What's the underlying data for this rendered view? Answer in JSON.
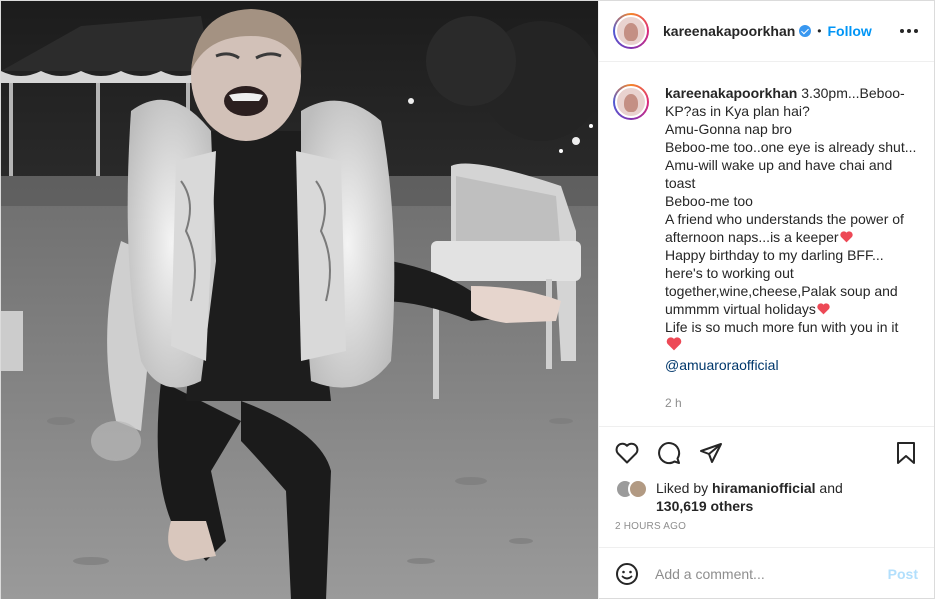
{
  "header": {
    "username": "kareenakapoorkhan",
    "separator": "•",
    "follow_label": "Follow"
  },
  "caption": {
    "username": "kareenakapoorkhan",
    "lines": [
      "3.30pm...Beboo-KP?as in Kya plan hai?",
      "Amu-Gonna nap bro",
      "Beboo-me too..one eye is already shut...",
      "Amu-will wake up and have chai and toast",
      "Beboo-me too",
      "A friend who understands the power of afternoon naps...is a keeper",
      "Happy birthday to my darling BFF... here's to working out together,wine,cheese,Palak soup and ummmm virtual holidays",
      "Life is so much more fun with you in it"
    ],
    "mention": "@amuaroraofficial",
    "time_ago": "2 h"
  },
  "likes": {
    "prefix": "Liked by",
    "user": "hiramaniofficial",
    "conj": "and",
    "count": "130,619 others"
  },
  "timestamp": "2 HOURS AGO",
  "comment": {
    "placeholder": "Add a comment...",
    "post_label": "Post"
  },
  "colors": {
    "link": "#0095f6",
    "mention": "#00376b",
    "heart": "#ed4956",
    "muted": "#8e8e8e"
  },
  "icons": [
    "heart-icon",
    "comment-icon",
    "share-icon",
    "bookmark-icon",
    "emoji-icon",
    "more-icon",
    "verified-badge-icon"
  ]
}
